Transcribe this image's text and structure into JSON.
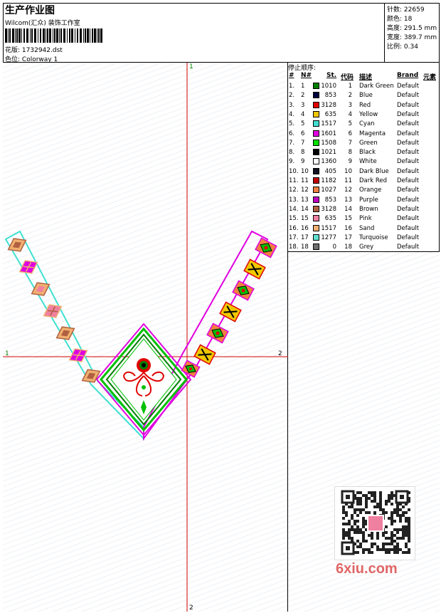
{
  "header": {
    "title": "生产作业图",
    "company": "Wilcom(汇众) 装饰工作室",
    "design_label": "花版:",
    "design_value": "1732942.dst",
    "colorway_label": "色位:",
    "colorway_value": "Colorway 1"
  },
  "stats": [
    {
      "label": "针数:",
      "value": "22659"
    },
    {
      "label": "颜色:",
      "value": "18"
    },
    {
      "label": "高度:",
      "value": "291.5 mm"
    },
    {
      "label": "宽度:",
      "value": "389.7 mm"
    },
    {
      "label": "比例:",
      "value": "0.34"
    }
  ],
  "axes": {
    "top": "1",
    "bottom": "2",
    "left": "1",
    "right": "2"
  },
  "stop_sequence": {
    "title": "停止顺序:",
    "columns": [
      "#",
      "N#",
      "St.",
      "代码",
      "描述",
      "Brand",
      "元素"
    ],
    "rows": [
      {
        "idx": "1.",
        "n": "1",
        "st": "1010",
        "code": "1",
        "desc": "Dark Green",
        "brand": "Default",
        "color": "#008000"
      },
      {
        "idx": "2.",
        "n": "2",
        "st": "853",
        "code": "2",
        "desc": "Blue",
        "brand": "Default",
        "color": "#000040"
      },
      {
        "idx": "3.",
        "n": "3",
        "st": "3128",
        "code": "3",
        "desc": "Red",
        "brand": "Default",
        "color": "#e00000"
      },
      {
        "idx": "4.",
        "n": "4",
        "st": "635",
        "code": "4",
        "desc": "Yellow",
        "brand": "Default",
        "color": "#f0c800"
      },
      {
        "idx": "5.",
        "n": "5",
        "st": "1517",
        "code": "5",
        "desc": "Cyan",
        "brand": "Default",
        "color": "#40e0d0"
      },
      {
        "idx": "6.",
        "n": "6",
        "st": "1601",
        "code": "6",
        "desc": "Magenta",
        "brand": "Default",
        "color": "#e000e0"
      },
      {
        "idx": "7.",
        "n": "7",
        "st": "1508",
        "code": "7",
        "desc": "Green",
        "brand": "Default",
        "color": "#00e000"
      },
      {
        "idx": "8.",
        "n": "8",
        "st": "1021",
        "code": "8",
        "desc": "Black",
        "brand": "Default",
        "color": "#000000"
      },
      {
        "idx": "9.",
        "n": "9",
        "st": "1360",
        "code": "9",
        "desc": "White",
        "brand": "Default",
        "color": "#ffffff"
      },
      {
        "idx": "10.",
        "n": "10",
        "st": "405",
        "code": "10",
        "desc": "Dark Blue",
        "brand": "Default",
        "color": "#101020"
      },
      {
        "idx": "11.",
        "n": "11",
        "st": "1182",
        "code": "11",
        "desc": "Dark Red",
        "brand": "Default",
        "color": "#c00000"
      },
      {
        "idx": "12.",
        "n": "12",
        "st": "1027",
        "code": "12",
        "desc": "Orange",
        "brand": "Default",
        "color": "#f08040"
      },
      {
        "idx": "13.",
        "n": "13",
        "st": "853",
        "code": "13",
        "desc": "Purple",
        "brand": "Default",
        "color": "#c000c0"
      },
      {
        "idx": "14.",
        "n": "14",
        "st": "3128",
        "code": "14",
        "desc": "Brown",
        "brand": "Default",
        "color": "#b06040"
      },
      {
        "idx": "15.",
        "n": "15",
        "st": "635",
        "code": "15",
        "desc": "Pink",
        "brand": "Default",
        "color": "#f080a0"
      },
      {
        "idx": "16.",
        "n": "16",
        "st": "1517",
        "code": "16",
        "desc": "Sand",
        "brand": "Default",
        "color": "#f0b070"
      },
      {
        "idx": "17.",
        "n": "17",
        "st": "1277",
        "code": "17",
        "desc": "Turquoise",
        "brand": "Default",
        "color": "#60e0d0"
      },
      {
        "idx": "18.",
        "n": "18",
        "st": "0",
        "code": "18",
        "desc": "Grey",
        "brand": "Default",
        "color": "#707070"
      }
    ]
  },
  "watermark": "6xiu.com"
}
